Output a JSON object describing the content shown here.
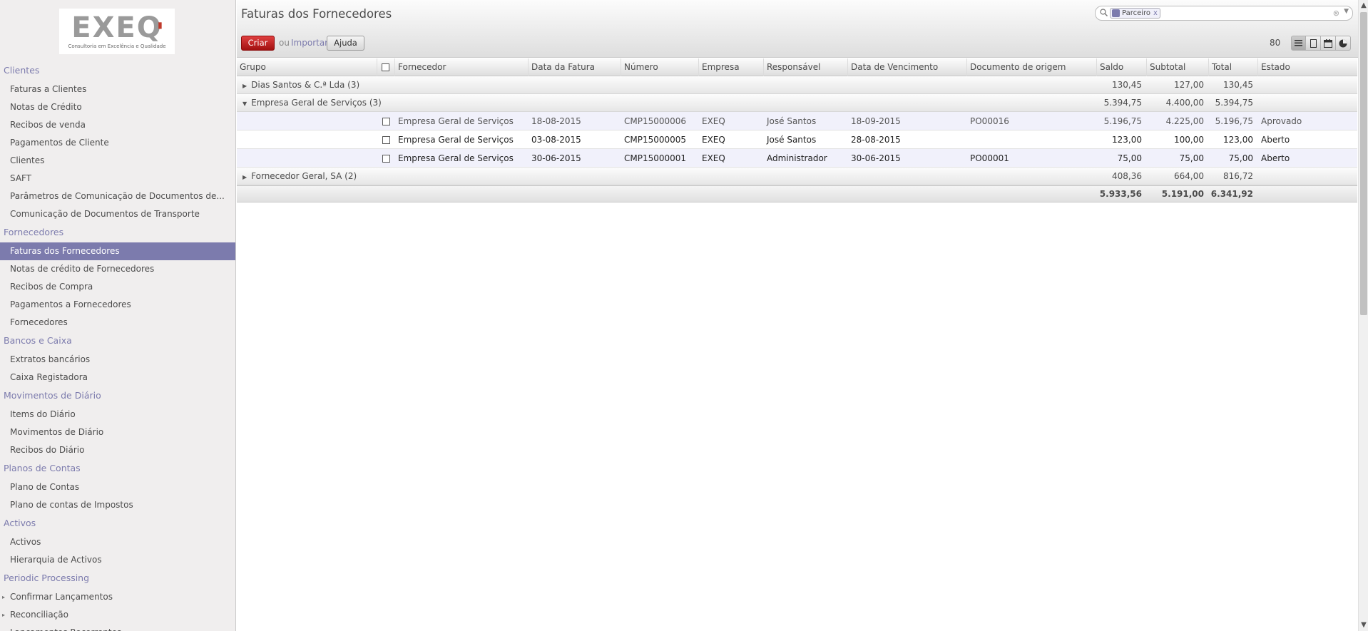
{
  "sidebar": {
    "logo": {
      "brand": "EXEQ",
      "tagline": "Consultoria em Excelência e Qualidade"
    },
    "sections": [
      {
        "title": "Clientes",
        "items": [
          "Faturas a Clientes",
          "Notas de Crédito",
          "Recibos de venda",
          "Pagamentos de Cliente",
          "Clientes",
          "SAFT",
          "Parâmetros de Comunicação de Documentos de...",
          "Comunicação de Documentos de Transporte"
        ]
      },
      {
        "title": "Fornecedores",
        "items": [
          "Faturas dos Fornecedores",
          "Notas de crédito de Fornecedores",
          "Recibos de Compra",
          "Pagamentos a Fornecedores",
          "Fornecedores"
        ]
      },
      {
        "title": "Bancos e Caixa",
        "items": [
          "Extratos bancários",
          "Caixa Registadora"
        ]
      },
      {
        "title": "Movimentos de Diário",
        "items": [
          "Items do Diário",
          "Movimentos de Diário",
          "Recibos do Diário"
        ]
      },
      {
        "title": "Planos de Contas",
        "items": [
          "Plano de Contas",
          "Plano de contas de Impostos"
        ]
      },
      {
        "title": "Activos",
        "items": [
          "Activos",
          "Hierarquia de Activos"
        ]
      },
      {
        "title": "Periodic Processing",
        "items": [
          "Confirmar Lançamentos",
          "Reconciliação",
          "Lançamentos Recorrentes"
        ]
      }
    ],
    "active_item": "Faturas dos Fornecedores"
  },
  "header": {
    "title": "Faturas dos Fornecedores",
    "search": {
      "facet_label": "Parceiro",
      "facet_remove": "x",
      "placeholder": ""
    },
    "create_label": "Criar",
    "or_label": "ou",
    "import_label": "Importar",
    "help_label": "Ajuda",
    "record_count": "80",
    "colors": {
      "accent": "#7c7bad",
      "create": "#c62828"
    }
  },
  "table": {
    "columns": [
      "Grupo",
      "Fornecedor",
      "Data da Fatura",
      "Número",
      "Empresa",
      "Responsável",
      "Data de Vencimento",
      "Documento de origem",
      "Saldo",
      "Subtotal",
      "Total",
      "Estado"
    ],
    "groups": [
      {
        "name": "Dias Santos & C.ª Lda (3)",
        "expanded": false,
        "saldo": "130,45",
        "subtotal": "127,00",
        "total": "130,45",
        "rows": []
      },
      {
        "name": "Empresa Geral de Serviços (3)",
        "expanded": true,
        "saldo": "5.394,75",
        "subtotal": "4.400,00",
        "total": "5.394,75",
        "rows": [
          {
            "fornecedor": "Empresa Geral de Serviços",
            "data": "18-08-2015",
            "numero": "CMP15000006",
            "empresa": "EXEQ",
            "responsavel": "José Santos",
            "vencimento": "18-09-2015",
            "origem": "PO00016",
            "saldo": "5.196,75",
            "subtotal": "4.225,00",
            "total": "5.196,75",
            "estado": "Aprovado"
          },
          {
            "fornecedor": "Empresa Geral de Serviços",
            "data": "03-08-2015",
            "numero": "CMP15000005",
            "empresa": "EXEQ",
            "responsavel": "José Santos",
            "vencimento": "28-08-2015",
            "origem": "",
            "saldo": "123,00",
            "subtotal": "100,00",
            "total": "123,00",
            "estado": "Aberto"
          },
          {
            "fornecedor": "Empresa Geral de Serviços",
            "data": "30-06-2015",
            "numero": "CMP15000001",
            "empresa": "EXEQ",
            "responsavel": "Administrador",
            "vencimento": "30-06-2015",
            "origem": "PO00001",
            "saldo": "75,00",
            "subtotal": "75,00",
            "total": "75,00",
            "estado": "Aberto"
          }
        ]
      },
      {
        "name": "Fornecedor Geral, SA (2)",
        "expanded": false,
        "saldo": "408,36",
        "subtotal": "664,00",
        "total": "816,72",
        "rows": []
      }
    ],
    "totals": {
      "saldo": "5.933,56",
      "subtotal": "5.191,00",
      "total": "6.341,92"
    }
  }
}
